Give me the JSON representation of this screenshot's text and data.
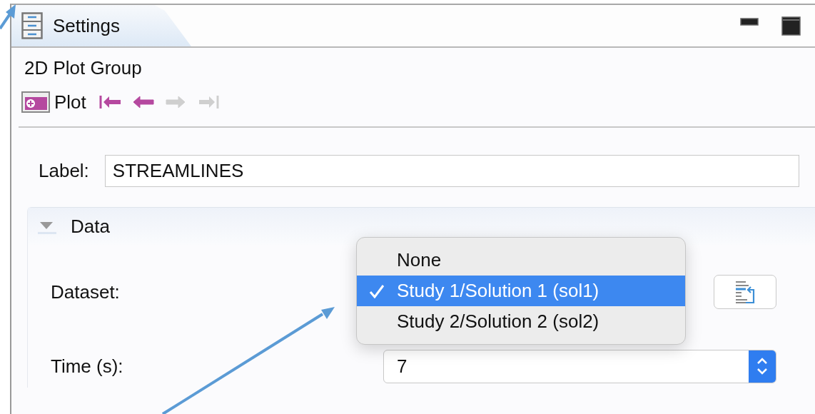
{
  "tab": {
    "label": "Settings",
    "selected": true
  },
  "title": "2D Plot Group",
  "toolbar": {
    "plot": "Plot",
    "nav": [
      {
        "kind": "first",
        "disabled": false
      },
      {
        "kind": "previous",
        "disabled": false
      },
      {
        "kind": "next",
        "disabled": true
      },
      {
        "kind": "last",
        "disabled": true
      }
    ]
  },
  "label_field": {
    "label": "Label:",
    "value": "STREAMLINES"
  },
  "section": {
    "title": "Data",
    "expanded": true,
    "fields": [
      {
        "kind": "dataset",
        "label": "Dataset:"
      },
      {
        "kind": "select",
        "label": "Time (s):",
        "value": "7"
      }
    ]
  },
  "dropdown": {
    "options": [
      {
        "label": "None",
        "selected": false
      },
      {
        "label": "Study 1/Solution 1 (sol1)",
        "selected": true
      },
      {
        "label": "Study 2/Solution 2 (sol2)",
        "selected": false
      }
    ]
  }
}
